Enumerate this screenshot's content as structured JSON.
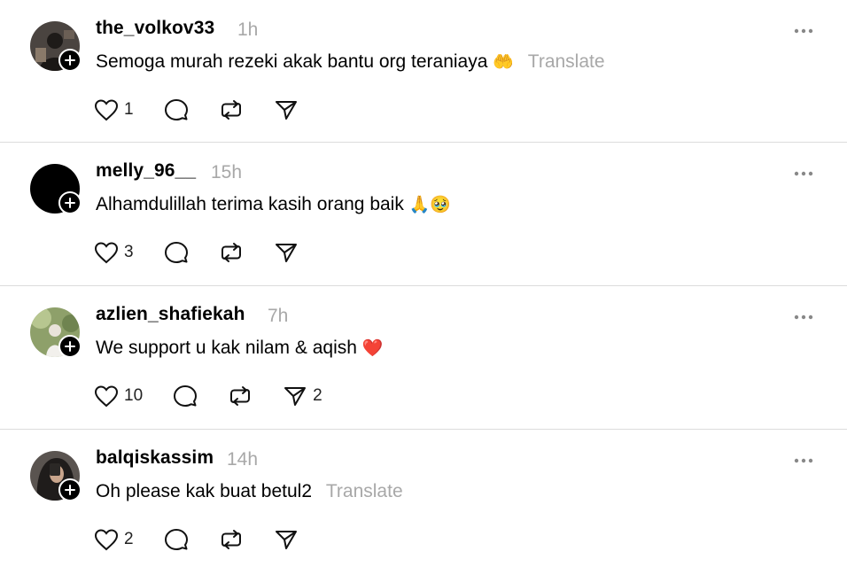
{
  "posts": [
    {
      "username": "the_volkov33",
      "time": "1h",
      "text": "Semoga murah rezeki akak bantu org teraniaya",
      "emoji": "🤲",
      "emoji_color": "#f4c23b",
      "translate": "Translate",
      "likes": "1",
      "reposts": "",
      "shares": "",
      "avatar_color": "#2d2a27"
    },
    {
      "username": "melly_96__",
      "time": "15h",
      "text": "Alhamdulillah terima kasih orang baik",
      "emoji": "🙏🥹",
      "emoji_color": "#e8b98c",
      "translate": "",
      "likes": "3",
      "shares": "",
      "avatar_color": "#000000"
    },
    {
      "username": "azlien_shafiekah",
      "time": "7h",
      "text": "We support u kak nilam & aqish",
      "emoji": "❤️",
      "emoji_color": "#e0252b",
      "translate": "",
      "likes": "10",
      "shares": "2",
      "avatar_color": "#7a8f55"
    },
    {
      "username": "balqiskassim",
      "time": "14h",
      "text": "Oh please kak buat betul2",
      "emoji": "",
      "emoji_color": "",
      "translate": "Translate",
      "likes": "2",
      "shares": "",
      "avatar_color": "#3a3633"
    }
  ]
}
